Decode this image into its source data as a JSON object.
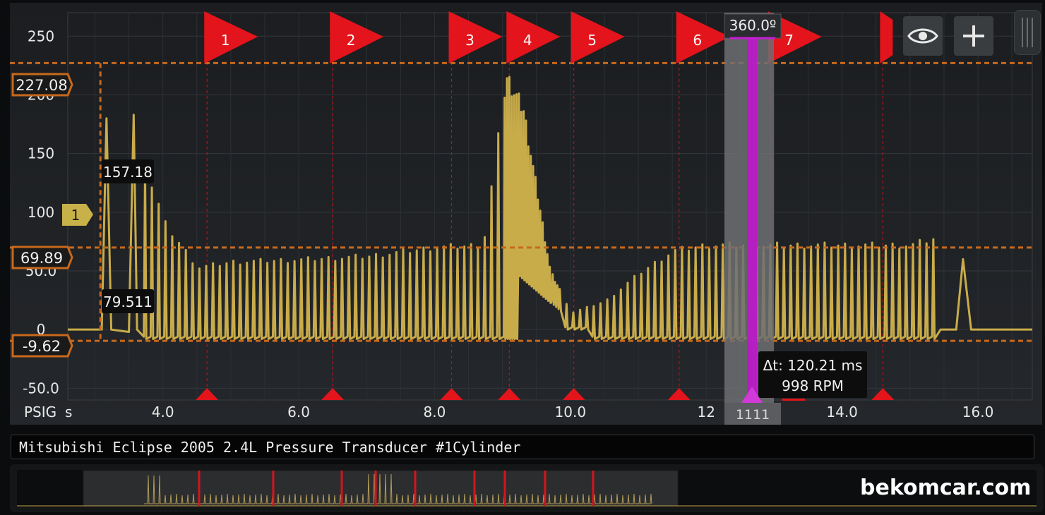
{
  "scope": {
    "unit_label": "PSIG",
    "time_unit_label": "s",
    "y_ticks": [
      "250",
      "200",
      "150",
      "100",
      "50.0",
      "0",
      "-50.0"
    ],
    "x_ticks": [
      "4.0",
      "6.0",
      "8.0",
      "10.0",
      "12",
      "14.0",
      "16.0"
    ],
    "cursor_labels": {
      "upper_level": "227.08",
      "mid_level": "69.89",
      "lower_level": "-9.62",
      "value_157": "157.18",
      "value_79": "79.511"
    },
    "channel_marker": "1",
    "phase_cursor_label": "360.0º",
    "phase_cursor_readout": "1111",
    "delta_time": "Δt: 120.21 ms",
    "rpm": "998 RPM",
    "flags": [
      "1",
      "2",
      "3",
      "4",
      "5",
      "6",
      "7"
    ],
    "colors": {
      "trace": "#c9ac4a",
      "cursor_orange": "#c8691c",
      "flag_red": "#e3141b",
      "phase_cursor": "#b51fc1",
      "background": "#202327"
    }
  },
  "toolbar": {
    "eye_button_icon": "eye-icon",
    "add_button_icon": "plus-icon"
  },
  "title": "Mitsubishi Eclipse 2005 2.4L Pressure Transducer  #1Cylinder",
  "watermark": "bekomcar.com",
  "chart_data": {
    "type": "line",
    "xlabel": "s",
    "ylabel": "PSIG",
    "xlim": [
      2.6,
      16.8
    ],
    "ylim": [
      -60,
      270
    ],
    "x_ticks": [
      4.0,
      6.0,
      8.0,
      10.0,
      12.0,
      14.0,
      16.0
    ],
    "y_ticks": [
      250,
      200,
      150,
      100,
      50,
      0,
      -50
    ],
    "grid": true,
    "series": [
      {
        "description_points": [
          [
            3.2,
            180
          ],
          [
            3.6,
            183
          ],
          [
            3.75,
            140
          ],
          [
            3.9,
            115
          ],
          [
            4.0,
            95
          ],
          [
            4.5,
            55
          ],
          [
            5.0,
            60
          ],
          [
            6.0,
            62
          ],
          [
            7.0,
            65
          ],
          [
            8.0,
            73
          ],
          [
            8.7,
            75
          ],
          [
            9.05,
            225
          ],
          [
            9.3,
            195
          ],
          [
            9.7,
            50
          ],
          [
            10.0,
            15
          ],
          [
            10.5,
            25
          ],
          [
            11.0,
            50
          ],
          [
            11.5,
            70
          ],
          [
            12.0,
            75
          ],
          [
            13.0,
            75
          ],
          [
            14.0,
            75
          ],
          [
            15.0,
            75
          ],
          [
            15.4,
            82
          ],
          [
            15.8,
            60
          ]
        ]
      }
    ],
    "cursors": {
      "upper": 227.08,
      "mid": 69.89,
      "lower": -9.62
    }
  }
}
